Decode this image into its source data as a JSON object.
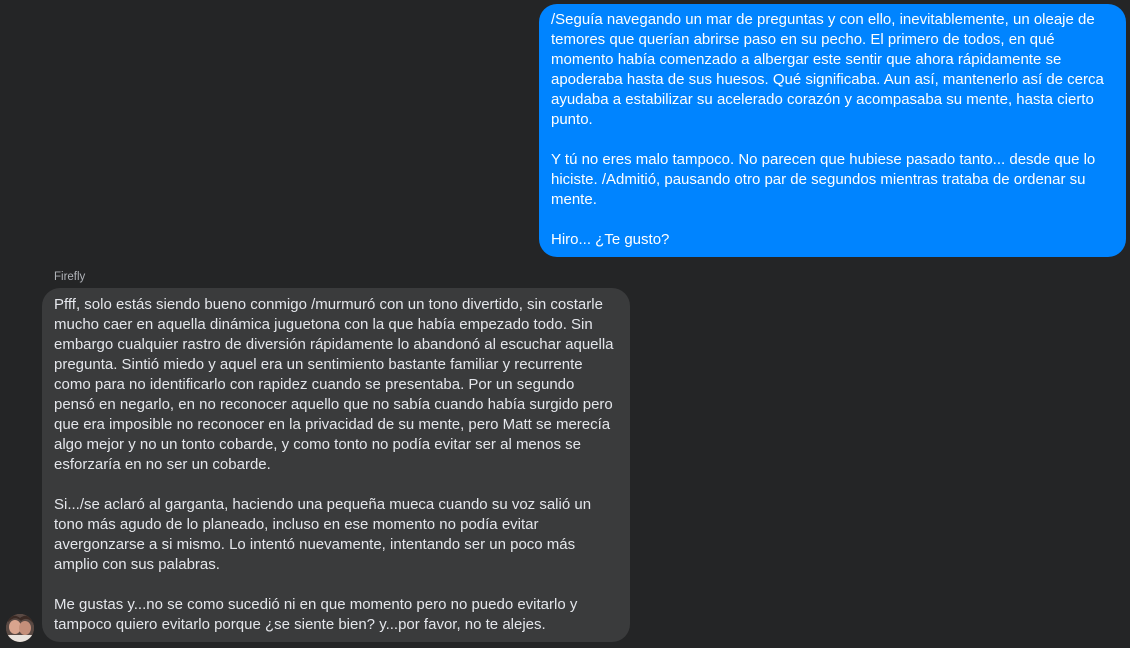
{
  "conversation": {
    "outgoing_message": {
      "paragraphs": [
        "/Seguía navegando un mar de preguntas y con ello, inevitablemente, un oleaje de temores que querían abrirse paso en su pecho. El primero de todos, en qué momento había comenzado a albergar este sentir que ahora rápidamente se apoderaba hasta de sus huesos. Qué significaba. Aun así, mantenerlo así de cerca ayudaba a estabilizar su acelerado corazón y acompasaba su mente, hasta cierto punto.",
        "Y tú no eres malo tampoco. No parecen que hubiese pasado tanto... desde que lo hiciste. /Admitió, pausando otro par de segundos mientras trataba de ordenar su mente.",
        "Hiro... ¿Te gusto?"
      ]
    },
    "incoming_message": {
      "sender": "Firefly",
      "paragraphs": [
        "Pfff, solo estás siendo bueno conmigo /murmuró con un tono divertido, sin costarle mucho caer en aquella dinámica juguetona con la que había empezado todo. Sin embargo cualquier rastro de diversión rápidamente lo abandonó al escuchar aquella pregunta. Sintió miedo y aquel era un sentimiento bastante familiar y recurrente como para no identificarlo con rapidez cuando se presentaba. Por un segundo pensó en negarlo, en no reconocer aquello que no sabía cuando había surgido pero que era imposible no reconocer en la privacidad de su mente, pero Matt se merecía algo mejor y no un tonto cobarde, y como tonto no podía evitar ser al menos se esforzaría en no ser un cobarde.",
        "Si.../se aclaró al garganta, haciendo una pequeña mueca cuando su voz salió un tono más agudo de lo planeado, incluso en ese momento no podía evitar avergonzarse a si mismo. Lo intentó nuevamente, intentando ser un poco más amplio con sus palabras.",
        "Me gustas y...no se como sucedió ni en que momento pero no puedo evitarlo y tampoco quiero evitarlo porque ¿se siente bien? y...por favor, no te alejes."
      ]
    }
  },
  "colors": {
    "background": "#242526",
    "outgoing_bubble": "#0084ff",
    "incoming_bubble": "#3a3b3c"
  },
  "icons": {
    "avatar": "user-avatar-photo"
  }
}
